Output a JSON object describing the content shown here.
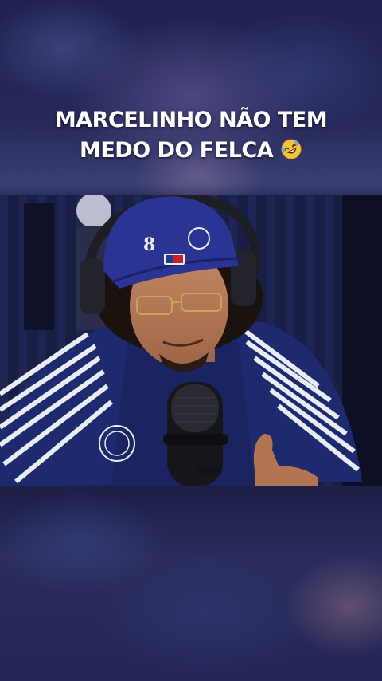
{
  "caption": {
    "line1": "MARCELINHO NÃO TEM",
    "line2": "MEDO DO FELCA",
    "emoji_icon": "rolling-on-floor-laughing-emoji"
  },
  "video": {
    "subject": "podcast-guest-with-microphone",
    "colors": {
      "backdrop": "#1b1f4a",
      "shirt": "#1e2a6e",
      "stripes": "#e8ecf4",
      "cap": "#2a3492"
    }
  }
}
